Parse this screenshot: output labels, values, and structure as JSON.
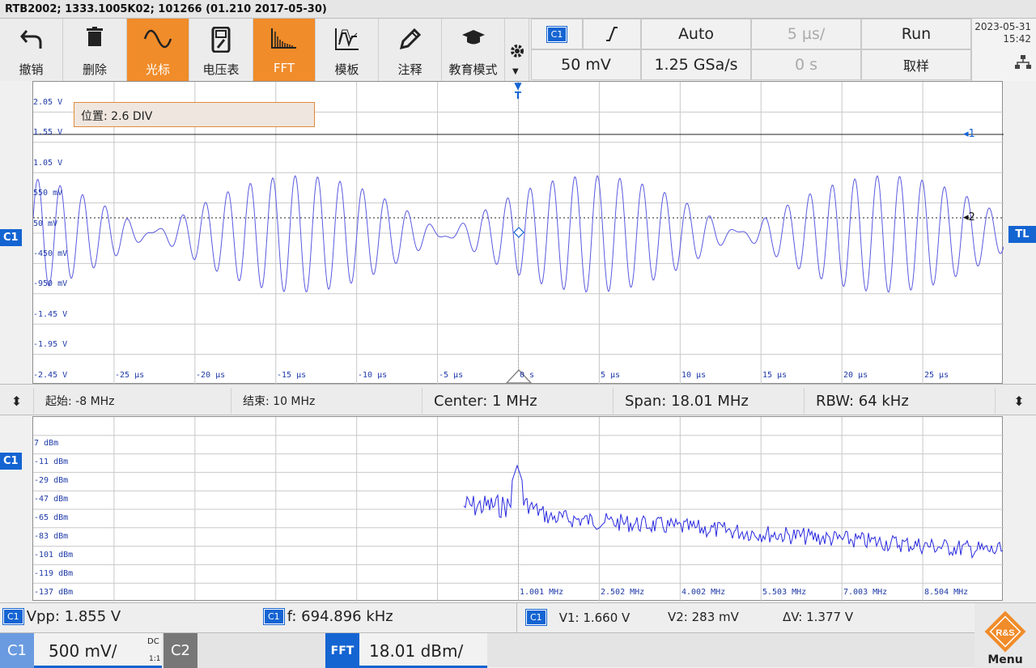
{
  "window_title": "RTB2002; 1333.1005K02; 101266 (01.210 2017-05-30)",
  "toolbar": {
    "buttons": [
      {
        "label": "撤销",
        "icon": "undo-icon"
      },
      {
        "label": "删除",
        "icon": "trash-icon"
      },
      {
        "label": "光标",
        "icon": "cursor-wave-icon",
        "active": true
      },
      {
        "label": "电压表",
        "icon": "voltmeter-icon"
      },
      {
        "label": "FFT",
        "icon": "fft-icon",
        "active": true
      },
      {
        "label": "模板",
        "icon": "mask-icon"
      },
      {
        "label": "注释",
        "icon": "pen-icon"
      },
      {
        "label": "教育模式",
        "icon": "graduation-cap-icon"
      }
    ],
    "settings_icon": "gear-icon"
  },
  "acquisition": {
    "channel_tag": "C1",
    "trigger_slope_icon": "rising-edge-icon",
    "trigger_mode": "Auto",
    "timebase": "5 µs/",
    "run_state": "Run",
    "vertical_scale": "50 mV",
    "sample_rate": "1.25 GSa/s",
    "time_offset": "0 s",
    "sampling_label": "取样",
    "date": "2023-05-31",
    "time": "15:42",
    "network_icon": "network-icon"
  },
  "scope": {
    "position_tooltip": "位置: 2.6 DIV",
    "trigger_marker": "T",
    "trigger_level_tag": "TL",
    "channel_tag": "C1",
    "cursor1_label": "1",
    "cursor2_label": "2",
    "y_labels": [
      "2.05 V",
      "1.55 V",
      "1.05 V",
      "550 mV",
      "50 mV",
      "-450 mV",
      "-950 mV",
      "-1.45 V",
      "-1.95 V",
      "-2.45 V"
    ],
    "x_labels": [
      "-25 µs",
      "-20 µs",
      "-15 µs",
      "-10 µs",
      "-5 µs",
      "0 s",
      "5 µs",
      "10 µs",
      "15 µs",
      "20 µs",
      "25 µs"
    ]
  },
  "fft_bar": {
    "start": "起始: -8 MHz",
    "stop": "结束: 10 MHz",
    "center": "Center: 1 MHz",
    "span": "Span: 18.01 MHz",
    "rbw": "RBW: 64 kHz"
  },
  "fft": {
    "channel_tag": "C1",
    "y_labels": [
      "7 dBm",
      "-11 dBm",
      "-29 dBm",
      "-47 dBm",
      "-65 dBm",
      "-83 dBm",
      "-101 dBm",
      "-119 dBm",
      "-137 dBm"
    ],
    "x_labels": [
      "1.001 MHz",
      "2.502 MHz",
      "4.002 MHz",
      "5.503 MHz",
      "7.003 MHz",
      "8.504 MHz"
    ]
  },
  "measurements": {
    "vpp": "Vpp: 1.855 V",
    "freq": "f: 694.896 kHz",
    "v1": "V1: 1.660 V",
    "v2": "V2: 283 mV",
    "dv": "ΔV: 1.377 V"
  },
  "bottom": {
    "c1_label": "C1",
    "c1_scale": "500 mV/",
    "coupling": "DC",
    "probe": "1:1",
    "c2_label": "C2",
    "fft_label": "FFT",
    "fft_scale": "18.01 dBm/",
    "menu_label": "Menu",
    "logo_text": "R&S"
  },
  "colors": {
    "accent": "#f08c2a",
    "channel": "#1464d2",
    "trace": "#3a3ad6"
  }
}
